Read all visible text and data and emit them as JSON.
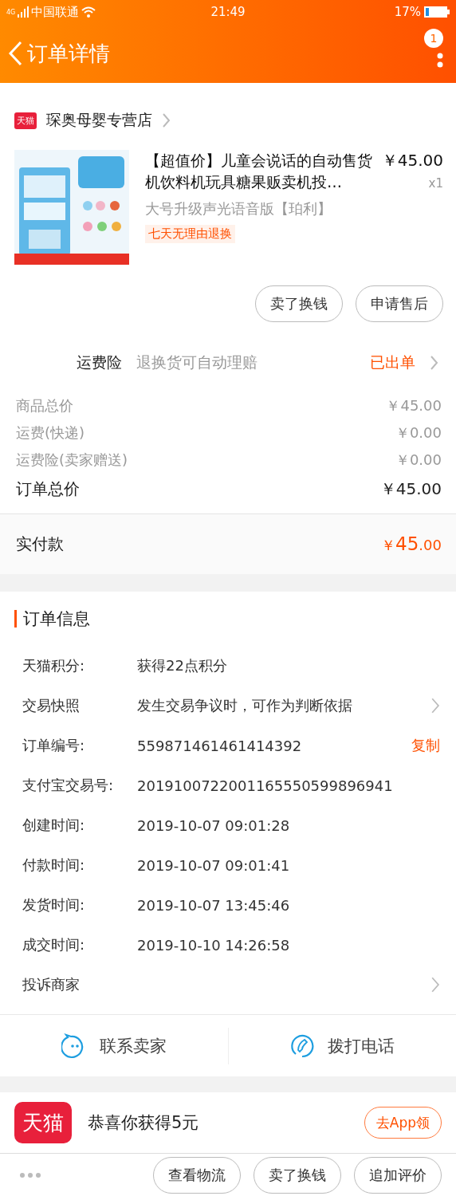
{
  "status_bar": {
    "network": "4G",
    "carrier": "中国联通",
    "time": "21:49",
    "battery": "17%"
  },
  "nav": {
    "title": "订单详情",
    "badge": "1"
  },
  "store": {
    "badge": "天猫",
    "name": "琛奥母婴专营店"
  },
  "product": {
    "title": "【超值价】儿童会说话的自动售货机饮料机玩具糖果贩卖机投…",
    "price": "￥45.00",
    "quantity": "x1",
    "sku": "大号升级声光语音版【珀利】",
    "tag": "七天无理由退换"
  },
  "product_actions": [
    "卖了换钱",
    "申请售后"
  ],
  "insurance": {
    "label": "运费险",
    "desc": "退换货可自动理赔",
    "status": "已出单"
  },
  "price_lines": [
    {
      "kind": "minor",
      "label": "商品总价",
      "value": "￥45.00"
    },
    {
      "kind": "minor",
      "label": "运费(快递)",
      "value": "￥0.00"
    },
    {
      "kind": "minor",
      "label": "运费险(卖家赠送)",
      "value": "￥0.00"
    },
    {
      "kind": "total",
      "label": "订单总价",
      "value": "￥45.00"
    }
  ],
  "paid": {
    "label": "实付款",
    "currency": "￥",
    "integer": "45",
    "decimal": ".00"
  },
  "order_info": {
    "title": "订单信息",
    "rows": [
      {
        "label": "天猫积分:",
        "value": "获得22点积分",
        "has_arrow": false
      },
      {
        "label": "交易快照",
        "value": "发生交易争议时，可作为判断依据",
        "has_arrow": true
      },
      {
        "label": "订单编号:",
        "value": "559871461461414392",
        "action": "复制",
        "has_arrow": false
      },
      {
        "label": "支付宝交易号:",
        "value": "2019100722001165550599896941",
        "has_arrow": false
      },
      {
        "label": "创建时间:",
        "value": "2019-10-07 09:01:28",
        "has_arrow": false
      },
      {
        "label": "付款时间:",
        "value": "2019-10-07 09:01:41",
        "has_arrow": false
      },
      {
        "label": "发货时间:",
        "value": "2019-10-07 13:45:46",
        "has_arrow": false
      },
      {
        "label": "成交时间:",
        "value": "2019-10-10 14:26:58",
        "has_arrow": false
      },
      {
        "label": "投诉商家",
        "has_arrow": true
      }
    ]
  },
  "contact": [
    {
      "kind": "chat",
      "label": "联系卖家"
    },
    {
      "kind": "phone",
      "label": "拨打电话"
    }
  ],
  "promo": {
    "badge": "天猫",
    "text": "恭喜你获得5元",
    "button": "去App领"
  },
  "bottom_bar": {
    "buttons": [
      "查看物流",
      "卖了换钱",
      "追加评价"
    ]
  }
}
